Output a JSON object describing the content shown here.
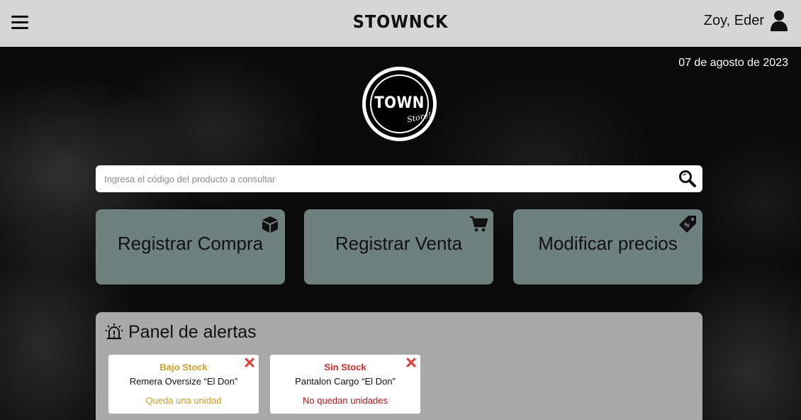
{
  "header": {
    "brand": "STOWNCK",
    "user_name": "Zoy, Eder",
    "menu_icon": "hamburger-menu-icon",
    "user_icon": "user-icon"
  },
  "date": "07 de agosto de 2023",
  "logo": {
    "town": "TOWN",
    "store": "Store!"
  },
  "search": {
    "placeholder": "Ingresa el código del producto a consultar",
    "value": "",
    "icon": "search-icon"
  },
  "actions": [
    {
      "label": "Registrar Compra",
      "icon": "box-icon"
    },
    {
      "label": "Registrar Venta",
      "icon": "cart-icon"
    },
    {
      "label": "Modificar precios",
      "icon": "price-tag-icon"
    }
  ],
  "alerts_panel": {
    "title": "Panel de alertas",
    "icon": "alarm-siren-icon",
    "alerts": [
      {
        "title": "Bajo Stock",
        "product": "Remera Oversize “El Don”",
        "status": "Queda una unidad",
        "color": "#c9a227"
      },
      {
        "title": "Sin Stock",
        "product": "Pantalon Cargo “El Don”",
        "status": "No quedan unidades",
        "color": "#d62b2b"
      }
    ]
  },
  "colors": {
    "topbar": "#d6d6d6",
    "action_card": "#6e817f",
    "panel": "#a9a9a9",
    "low_stock": "#c9a227",
    "no_stock": "#d62b2b",
    "no_stock_status": "#b01818"
  }
}
